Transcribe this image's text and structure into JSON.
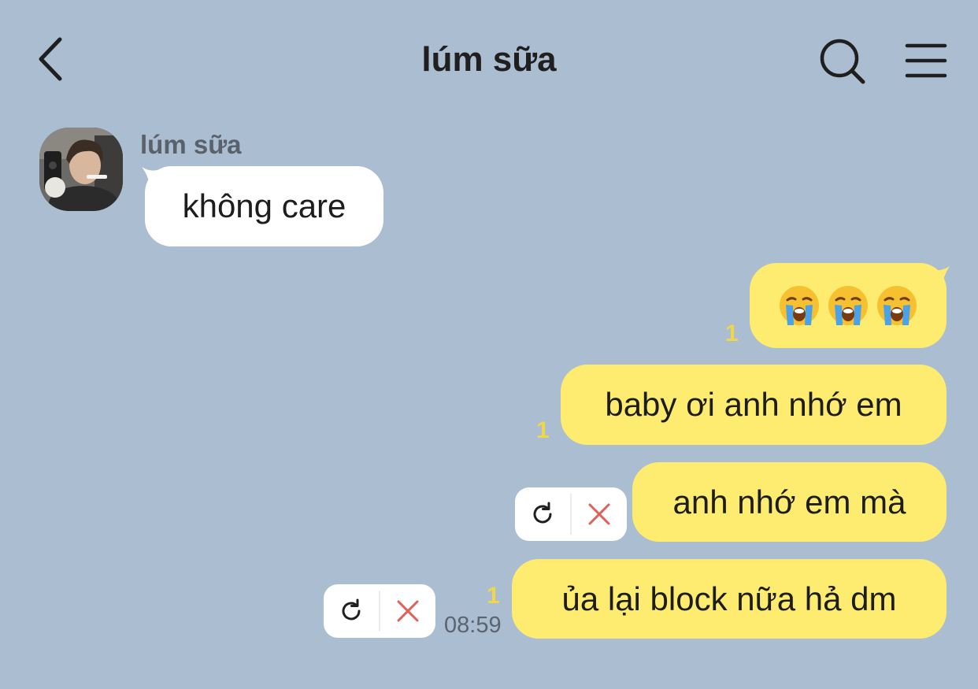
{
  "header": {
    "title": "lúm sữa",
    "back_icon": "chevron-left-icon",
    "search_icon": "search-icon",
    "menu_icon": "hamburger-menu-icon"
  },
  "messages": {
    "incoming": {
      "sender": "lúm sữa",
      "text": "không care"
    },
    "outgoing": [
      {
        "type": "emoji",
        "emoji": [
          "crying-face",
          "crying-face",
          "crying-face"
        ],
        "read_count": "1"
      },
      {
        "text": "baby ơi anh nhớ em",
        "read_count": "1"
      },
      {
        "text": "anh nhớ em mà",
        "failed": true
      },
      {
        "text": "ủa lại block nữa hả dm",
        "read_count": "1",
        "failed": true,
        "time": "08:59"
      }
    ]
  },
  "colors": {
    "background": "#abbdd1",
    "outgoing_bubble": "#fdec6f",
    "incoming_bubble": "#ffffff",
    "read_count": "#efd64a",
    "delete_x": "#e0605a"
  }
}
